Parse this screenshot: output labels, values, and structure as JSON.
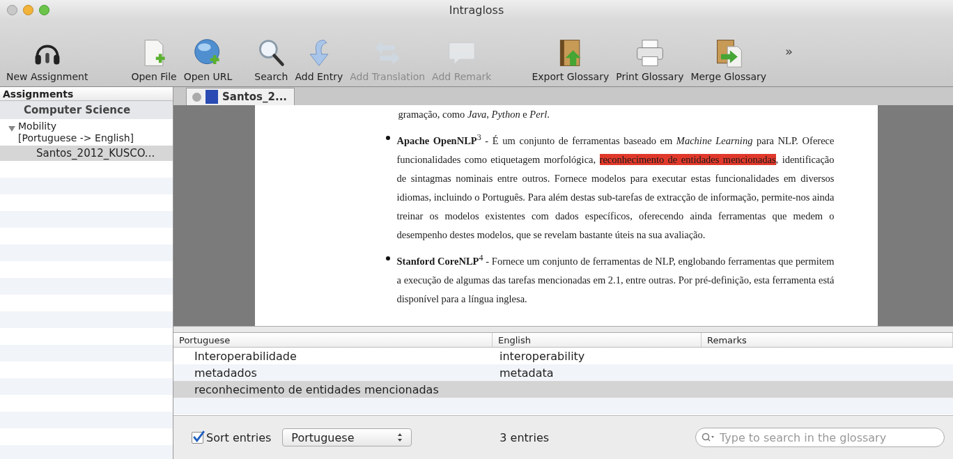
{
  "window": {
    "title": "Intragloss"
  },
  "toolbar": [
    {
      "label": "New Assignment",
      "disabled": false
    },
    {
      "label": "Open File",
      "disabled": false
    },
    {
      "label": "Open URL",
      "disabled": false
    },
    {
      "label": "Search",
      "disabled": false
    },
    {
      "label": "Add Entry",
      "disabled": false
    },
    {
      "label": "Add Translation",
      "disabled": true
    },
    {
      "label": "Add Remark",
      "disabled": true
    },
    {
      "label": "Export Glossary",
      "disabled": false
    },
    {
      "label": "Print Glossary",
      "disabled": false
    },
    {
      "label": "Merge Glossary",
      "disabled": false
    }
  ],
  "toolbar_overflow": "»",
  "sidebar": {
    "header": "Assignments",
    "items": [
      {
        "label": "Computer Science",
        "kind": "group",
        "selected": false
      },
      {
        "label": "Mobility\n[Portuguese -> English]",
        "kind": "assignment",
        "expanded": true,
        "selected": false,
        "children": [
          {
            "label": "Santos_2012_KUSCO...",
            "selected": true
          }
        ]
      }
    ]
  },
  "tabs": [
    {
      "label": "Santos_2...",
      "selected": true
    }
  ],
  "document": {
    "paragraphs": [
      {
        "kind": "text",
        "parts": [
          {
            "text": "gramação, como *Java*, *Python* e *Perl*.",
            "highlighted": false
          }
        ]
      },
      {
        "kind": "bullet",
        "parts": [
          {
            "text": "**Apache OpenNLP**$^{3}$ - É um conjunto de ferramentas baseado em *Machine Learning* para NLP. Oferece funcionalidades como etiquetagem morfológica, ",
            "highlighted": false
          },
          {
            "text": "reconhecimento de entidades mencionadas",
            "highlighted": true
          },
          {
            "text": ", identificação de sintagmas nominais entre outros.  Fornece modelos para executar estas funcionalidades em diversos idiomas, incluindo o Português. Para além destas sub-tarefas de extracção de informação, permite-nos ainda treinar os modelos existentes com dados específicos, oferecendo ainda ferramentas que medem o desempenho destes modelos, que se revelam bastante úteis na sua avaliação.",
            "highlighted": false
          }
        ]
      },
      {
        "kind": "bullet",
        "parts": [
          {
            "text": "**Stanford CoreNLP**$^{4}$ - Fornece um conjunto de ferramentas de NLP, englobando ferramentas que permitem a execução de algumas das tarefas mencionadas em 2.1, entre outras. Por pré-definição, esta ferramenta está disponível para a língua inglesa.",
            "highlighted": false
          }
        ]
      }
    ]
  },
  "glossary": {
    "columns": [
      "Portuguese",
      "English",
      "Remarks"
    ],
    "rows": [
      {
        "cells": [
          "Interoperabilidade",
          "interoperability",
          ""
        ],
        "selected": false
      },
      {
        "cells": [
          "metadados",
          "metadata",
          ""
        ],
        "selected": false
      },
      {
        "cells": [
          "reconhecimento de entidades mencionadas",
          "",
          ""
        ],
        "selected": true
      }
    ]
  },
  "footer": {
    "sort_checkbox": {
      "label": "Sort entries",
      "checked": true
    },
    "sort_select": "Portuguese",
    "count": "3 entries",
    "search": {
      "placeholder": "Type to search in the glossary"
    }
  }
}
